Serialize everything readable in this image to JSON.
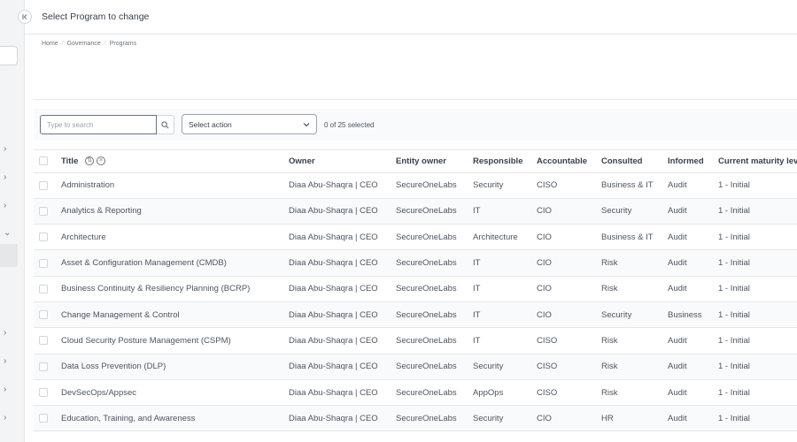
{
  "header": {
    "title": "Select Program to change"
  },
  "breadcrumb": [
    "Home",
    "Governance",
    "Programs"
  ],
  "toolbar": {
    "search_placeholder": "Type to search",
    "select_action": "Select action",
    "selected_count": "0 of 25 selected"
  },
  "table": {
    "columns": [
      "Title",
      "Owner",
      "Entity owner",
      "Responsible",
      "Accountable",
      "Consulted",
      "Informed",
      "Current maturity lev"
    ],
    "rows": [
      [
        "Administration",
        "Diaa Abu-Shaqra | CEO",
        "SecureOneLabs",
        "Security",
        "CISO",
        "Business & IT",
        "Audit",
        "1 - Initial"
      ],
      [
        "Analytics & Reporting",
        "Diaa Abu-Shaqra | CEO",
        "SecureOneLabs",
        "IT",
        "CIO",
        "Security",
        "Audit",
        "1 - Initial"
      ],
      [
        "Architecture",
        "Diaa Abu-Shaqra | CEO",
        "SecureOneLabs",
        "Architecture",
        "CIO",
        "Business & IT",
        "Audit",
        "1 - Initial"
      ],
      [
        "Asset & Configuration Management (CMDB)",
        "Diaa Abu-Shaqra | CEO",
        "SecureOneLabs",
        "IT",
        "CIO",
        "Risk",
        "Audit",
        "1 - Initial"
      ],
      [
        "Business Continuity & Resiliency Planning (BCRP)",
        "Diaa Abu-Shaqra | CEO",
        "SecureOneLabs",
        "IT",
        "CIO",
        "Risk",
        "Audit",
        "1 - Initial"
      ],
      [
        "Change Management & Control",
        "Diaa Abu-Shaqra | CEO",
        "SecureOneLabs",
        "IT",
        "CIO",
        "Security",
        "Business",
        "1 - Initial"
      ],
      [
        "Cloud Security Posture Management (CSPM)",
        "Diaa Abu-Shaqra | CEO",
        "SecureOneLabs",
        "IT",
        "CISO",
        "Risk",
        "Audit",
        "1 - Initial"
      ],
      [
        "Data Loss Prevention (DLP)",
        "Diaa Abu-Shaqra | CEO",
        "SecureOneLabs",
        "Security",
        "CISO",
        "Risk",
        "Audit",
        "1 - Initial"
      ],
      [
        "DevSecOps/Appsec",
        "Diaa Abu-Shaqra | CEO",
        "SecureOneLabs",
        "AppOps",
        "CISO",
        "Risk",
        "Audit",
        "1 - Initial"
      ],
      [
        "Education, Training, and Awareness",
        "Diaa Abu-Shaqra | CEO",
        "SecureOneLabs",
        "Security",
        "CIO",
        "HR",
        "Audit",
        "1 - Initial"
      ]
    ]
  },
  "icons": {
    "collapse": "collapse-sidebar-icon",
    "search": "search-icon",
    "dropdown": "chevron-down-icon",
    "sort": "sort-icon",
    "clear": "clear-icon",
    "sidebar_chevron": "chevron-right-icon"
  }
}
